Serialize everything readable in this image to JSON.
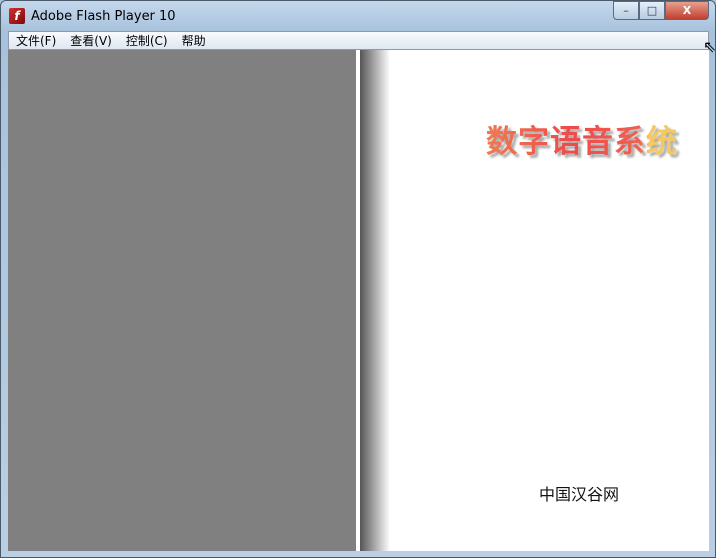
{
  "window": {
    "title": "Adobe Flash Player 10",
    "icon": "flash-icon",
    "controls": {
      "minimize": "–",
      "maximize": "□",
      "close": "X"
    }
  },
  "menu": [
    "文件(F)",
    "查看(V)",
    "控制(C)",
    "帮助"
  ],
  "book": {
    "title": "数字语音系统",
    "publisher": "中国汉谷网"
  }
}
